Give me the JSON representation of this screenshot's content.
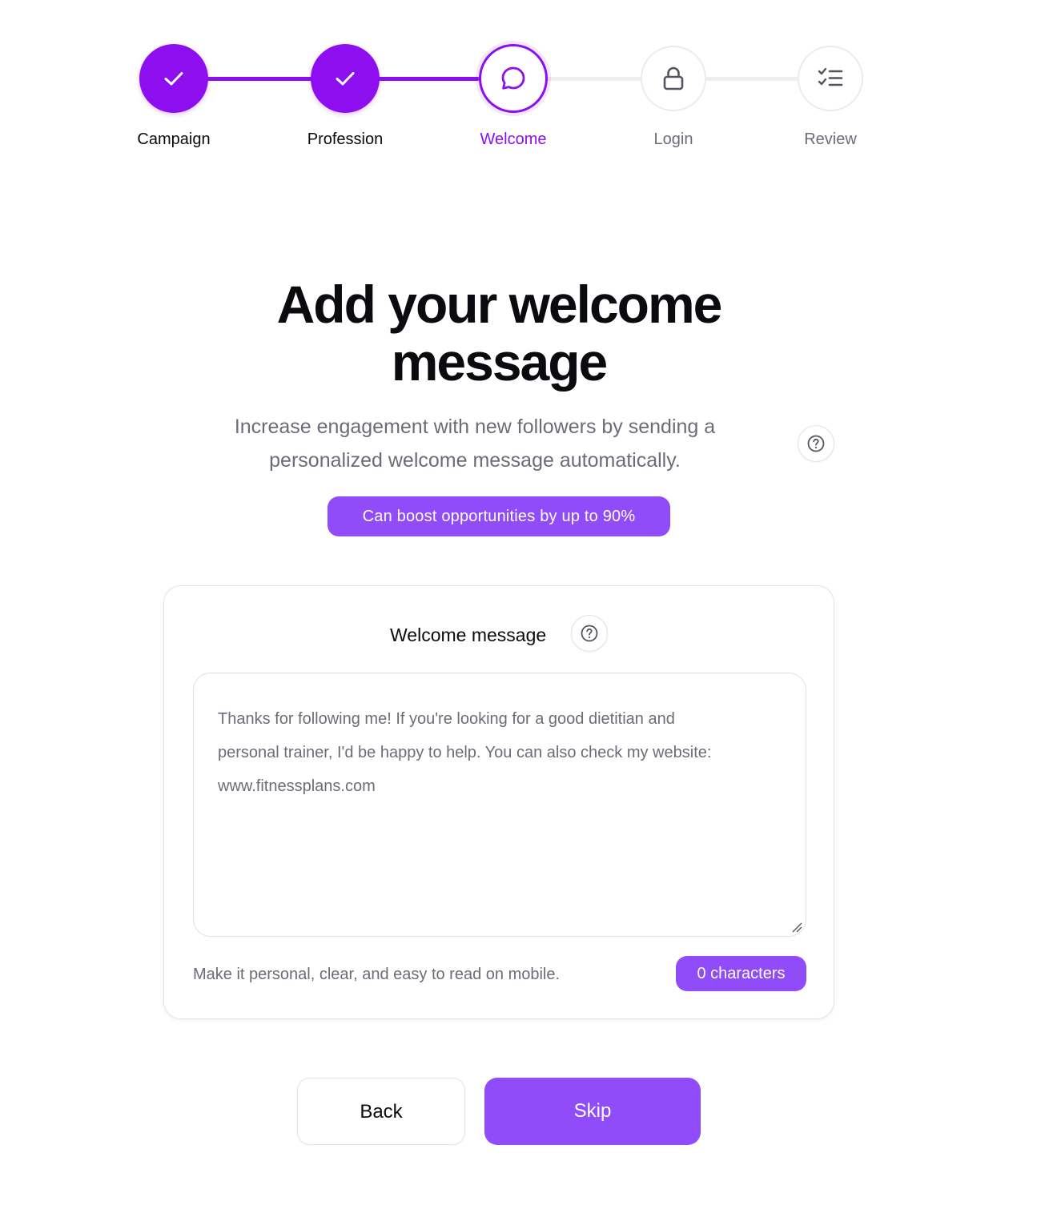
{
  "stepper": {
    "steps": [
      {
        "label": "Campaign",
        "state": "done",
        "icon": "check-icon"
      },
      {
        "label": "Profession",
        "state": "done",
        "icon": "check-icon"
      },
      {
        "label": "Welcome",
        "state": "current",
        "icon": "chat-bubble-icon"
      },
      {
        "label": "Login",
        "state": "todo",
        "icon": "lock-icon"
      },
      {
        "label": "Review",
        "state": "todo",
        "icon": "checklist-icon"
      }
    ]
  },
  "header": {
    "title_line1": "Add your welcome",
    "title_line2": "message",
    "subtitle_line1": "Increase engagement with new followers by sending a",
    "subtitle_line2": "personalized welcome message automatically.",
    "help_icon": "question-circle-icon",
    "badge": "Can boost opportunities by up to 90%"
  },
  "card": {
    "title": "Welcome message",
    "help_icon": "question-circle-icon",
    "message": {
      "line1": "Thanks for following me! If you're looking for a good dietitian and",
      "line2": "personal trainer, I'd be happy to help. You can also check my website:",
      "line3": "www.fitnessplans.com"
    },
    "hint": "Make it personal, clear, and easy to read on mobile.",
    "char_count": "0 characters"
  },
  "footer": {
    "back_label": "Back",
    "skip_label": "Skip"
  },
  "colors": {
    "accent": "#8d0ff0",
    "button_purple": "#8f4cf8",
    "muted_text": "#6c6c78",
    "border": "#e3e3e8"
  }
}
